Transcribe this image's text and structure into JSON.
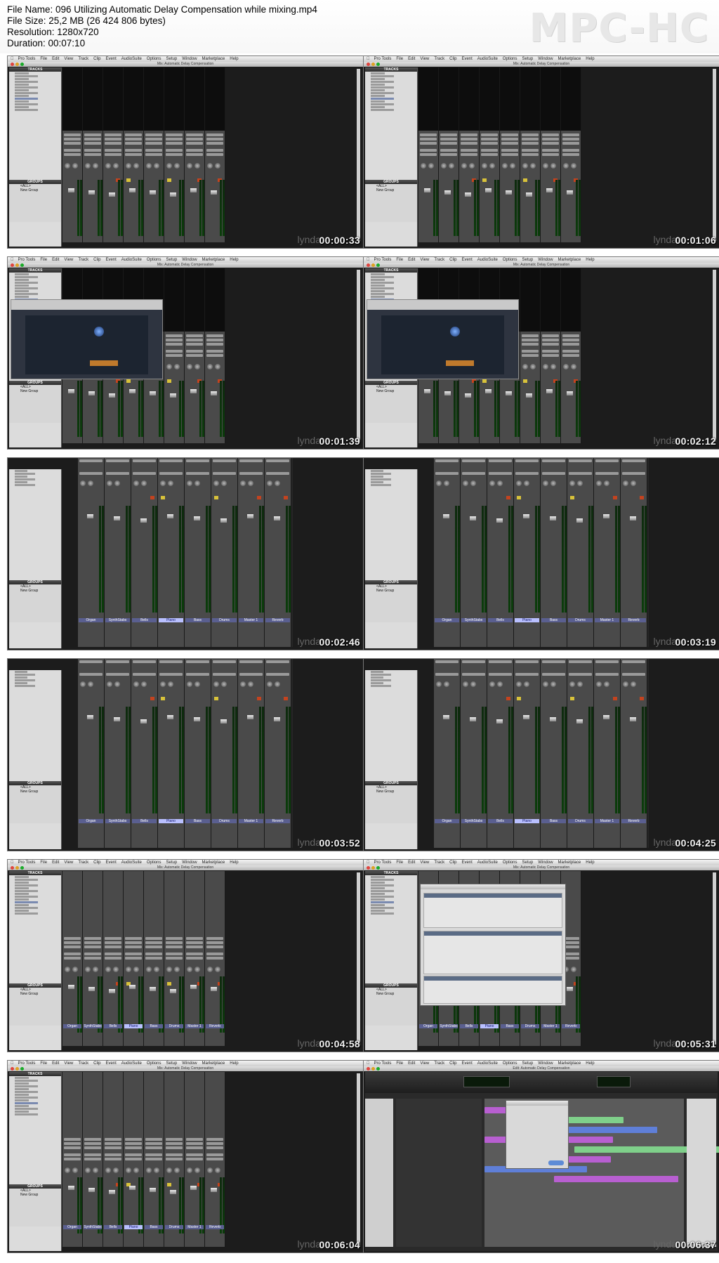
{
  "header": {
    "file_name": "File Name: 096 Utilizing Automatic Delay Compensation while mixing.mp4",
    "file_size": "File Size: 25,2 MB (26 424 806 bytes)",
    "resolution": "Resolution: 1280x720",
    "duration": "Duration: 00:07:10",
    "logo": "MPC-HC"
  },
  "app": {
    "menu": [
      "Pro Tools",
      "File",
      "Edit",
      "View",
      "Track",
      "Clip",
      "Event",
      "AudioSuite",
      "Options",
      "Setup",
      "Window",
      "Marketplace",
      "Help"
    ],
    "mix_window_title": "Mix: Automatic Delay Compensation",
    "edit_window_title": "Edit: Automatic Delay Compensation",
    "sidebar_tracks": "TRACKS",
    "sidebar_groups": "GROUPS",
    "group_items": [
      "<ALL>",
      "New Group"
    ],
    "track_names": [
      "Organ",
      "SynthStabs",
      "Bells",
      "Piano",
      "Bass",
      "Drums",
      "Master 1",
      "Reverb"
    ],
    "selected_track": "Piano",
    "watermark": "lynda"
  },
  "thumbnails": [
    {
      "timecode": "00:00:33",
      "kind": "mix_top"
    },
    {
      "timecode": "00:01:06",
      "kind": "mix_top"
    },
    {
      "timecode": "00:01:39",
      "kind": "plugin"
    },
    {
      "timecode": "00:02:12",
      "kind": "plugin"
    },
    {
      "timecode": "00:02:46",
      "kind": "mix_zoom"
    },
    {
      "timecode": "00:03:19",
      "kind": "mix_zoom"
    },
    {
      "timecode": "00:03:52",
      "kind": "mix_zoom"
    },
    {
      "timecode": "00:04:25",
      "kind": "mix_zoom"
    },
    {
      "timecode": "00:04:58",
      "kind": "mix_bottom"
    },
    {
      "timecode": "00:05:31",
      "kind": "dialog"
    },
    {
      "timecode": "00:06:04",
      "kind": "mix_bottom"
    },
    {
      "timecode": "00:06:37",
      "kind": "edit"
    }
  ],
  "colors": {
    "strip_name": "#5a5f90",
    "strip_selected": "#b9c0ff",
    "meter": "#0b3d0b",
    "button_yellow": "#d8c23a",
    "button_red": "#c4431f",
    "clip_purple": "#b85fd1",
    "clip_green": "#7fd08a",
    "clip_blue": "#5f7fd8"
  }
}
